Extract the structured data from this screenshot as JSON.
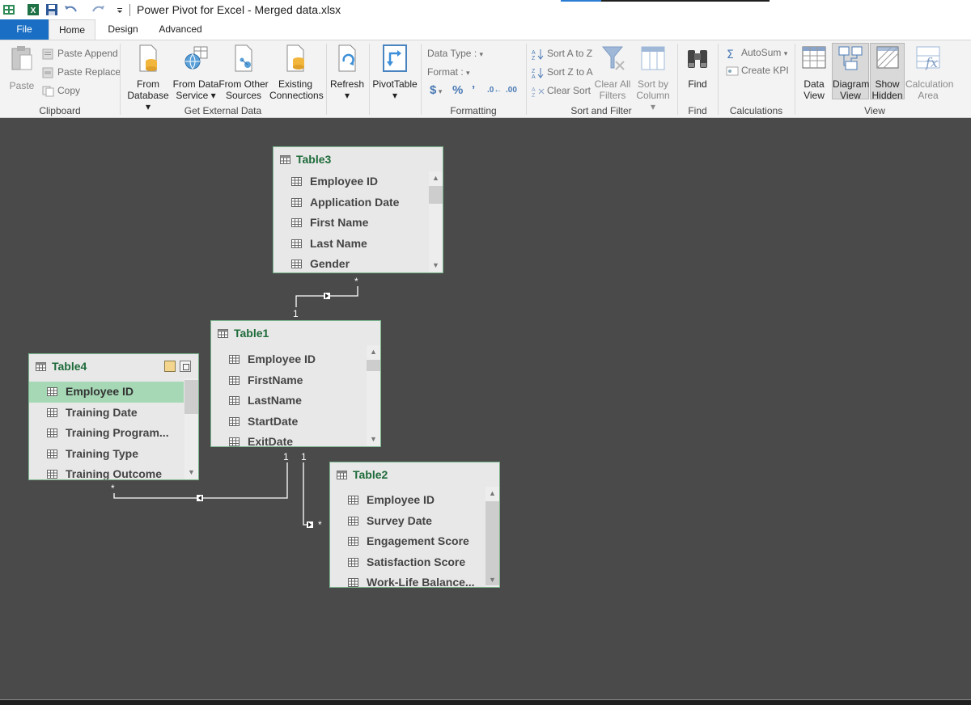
{
  "app": {
    "title": "Power Pivot for Excel - Merged data.xlsx"
  },
  "tabs": [
    {
      "label": "File"
    },
    {
      "label": "Home"
    },
    {
      "label": "Design"
    },
    {
      "label": "Advanced"
    }
  ],
  "ribbon": {
    "clipboard": {
      "paste": "Paste",
      "paste_append": "Paste Append",
      "paste_replace": "Paste Replace",
      "copy": "Copy",
      "group": "Clipboard"
    },
    "external": {
      "from_database": [
        "From",
        "Database"
      ],
      "from_data_service": [
        "From Data",
        "Service"
      ],
      "from_other_sources": [
        "From Other",
        "Sources"
      ],
      "existing_connections": [
        "Existing",
        "Connections"
      ],
      "group": "Get External Data"
    },
    "refresh": {
      "label": "Refresh"
    },
    "pivottable": {
      "label": "PivotTable"
    },
    "formatting": {
      "data_type": "Data Type :",
      "format": "Format :",
      "currency": "$",
      "percent": "%",
      "comma": "’",
      "inc_dec": ".0←",
      "dec_dec": ".00",
      "group": "Formatting"
    },
    "sort_filter": {
      "sort_az": "Sort A to Z",
      "sort_za": "Sort Z to A",
      "clear_sort": "Clear Sort",
      "clear_all_filters": [
        "Clear All",
        "Filters"
      ],
      "sort_by_column": [
        "Sort by",
        "Column"
      ],
      "group": "Sort and Filter"
    },
    "find": {
      "label": "Find",
      "group": "Find"
    },
    "calculations": {
      "autosum": "AutoSum",
      "create_kpi": "Create KPI",
      "group": "Calculations"
    },
    "view": {
      "data_view": [
        "Data",
        "View"
      ],
      "diagram_view": [
        "Diagram",
        "View"
      ],
      "show_hidden": [
        "Show",
        "Hidden"
      ],
      "calculation_area": [
        "Calculation",
        "Area"
      ],
      "group": "View"
    }
  },
  "tables": {
    "table3": {
      "name": "Table3",
      "columns": [
        "Employee ID",
        "Application Date",
        "First Name",
        "Last Name",
        "Gender"
      ]
    },
    "table1": {
      "name": "Table1",
      "columns": [
        "Employee ID",
        "FirstName",
        "LastName",
        "StartDate",
        "ExitDate"
      ]
    },
    "table4": {
      "name": "Table4",
      "columns": [
        "Employee ID",
        "Training Date",
        "Training Program...",
        "Training Type",
        "Training Outcome"
      ],
      "selected_column": "Employee ID"
    },
    "table2": {
      "name": "Table2",
      "columns": [
        "Employee ID",
        "Survey Date",
        "Engagement Score",
        "Satisfaction Score",
        "Work-Life Balance..."
      ]
    }
  },
  "relationships": [
    {
      "from": "Table3",
      "to": "Table1",
      "from_card": "*",
      "to_card": "1"
    },
    {
      "from": "Table4",
      "to": "Table1",
      "from_card": "*",
      "to_card": "1"
    },
    {
      "from": "Table2",
      "to": "Table1",
      "from_card": "*",
      "to_card": "1"
    }
  ],
  "colors": {
    "diagram_bg": "#4a4a4a",
    "table_title": "#1e6b3a",
    "selected_row": "#a6d8b5",
    "file_tab": "#1a6fc4"
  }
}
